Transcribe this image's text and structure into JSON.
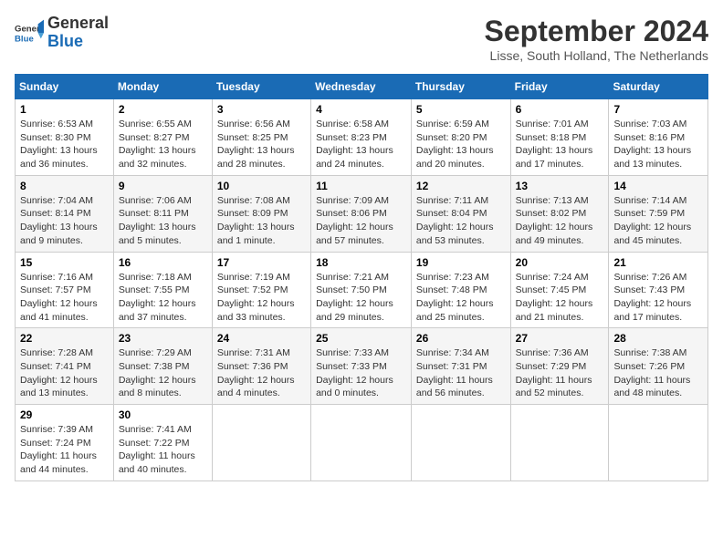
{
  "header": {
    "logo_general": "General",
    "logo_blue": "Blue",
    "month_title": "September 2024",
    "location": "Lisse, South Holland, The Netherlands"
  },
  "columns": [
    "Sunday",
    "Monday",
    "Tuesday",
    "Wednesday",
    "Thursday",
    "Friday",
    "Saturday"
  ],
  "weeks": [
    [
      {
        "day": "1",
        "info": "Sunrise: 6:53 AM\nSunset: 8:30 PM\nDaylight: 13 hours and 36 minutes."
      },
      {
        "day": "2",
        "info": "Sunrise: 6:55 AM\nSunset: 8:27 PM\nDaylight: 13 hours and 32 minutes."
      },
      {
        "day": "3",
        "info": "Sunrise: 6:56 AM\nSunset: 8:25 PM\nDaylight: 13 hours and 28 minutes."
      },
      {
        "day": "4",
        "info": "Sunrise: 6:58 AM\nSunset: 8:23 PM\nDaylight: 13 hours and 24 minutes."
      },
      {
        "day": "5",
        "info": "Sunrise: 6:59 AM\nSunset: 8:20 PM\nDaylight: 13 hours and 20 minutes."
      },
      {
        "day": "6",
        "info": "Sunrise: 7:01 AM\nSunset: 8:18 PM\nDaylight: 13 hours and 17 minutes."
      },
      {
        "day": "7",
        "info": "Sunrise: 7:03 AM\nSunset: 8:16 PM\nDaylight: 13 hours and 13 minutes."
      }
    ],
    [
      {
        "day": "8",
        "info": "Sunrise: 7:04 AM\nSunset: 8:14 PM\nDaylight: 13 hours and 9 minutes."
      },
      {
        "day": "9",
        "info": "Sunrise: 7:06 AM\nSunset: 8:11 PM\nDaylight: 13 hours and 5 minutes."
      },
      {
        "day": "10",
        "info": "Sunrise: 7:08 AM\nSunset: 8:09 PM\nDaylight: 13 hours and 1 minute."
      },
      {
        "day": "11",
        "info": "Sunrise: 7:09 AM\nSunset: 8:06 PM\nDaylight: 12 hours and 57 minutes."
      },
      {
        "day": "12",
        "info": "Sunrise: 7:11 AM\nSunset: 8:04 PM\nDaylight: 12 hours and 53 minutes."
      },
      {
        "day": "13",
        "info": "Sunrise: 7:13 AM\nSunset: 8:02 PM\nDaylight: 12 hours and 49 minutes."
      },
      {
        "day": "14",
        "info": "Sunrise: 7:14 AM\nSunset: 7:59 PM\nDaylight: 12 hours and 45 minutes."
      }
    ],
    [
      {
        "day": "15",
        "info": "Sunrise: 7:16 AM\nSunset: 7:57 PM\nDaylight: 12 hours and 41 minutes."
      },
      {
        "day": "16",
        "info": "Sunrise: 7:18 AM\nSunset: 7:55 PM\nDaylight: 12 hours and 37 minutes."
      },
      {
        "day": "17",
        "info": "Sunrise: 7:19 AM\nSunset: 7:52 PM\nDaylight: 12 hours and 33 minutes."
      },
      {
        "day": "18",
        "info": "Sunrise: 7:21 AM\nSunset: 7:50 PM\nDaylight: 12 hours and 29 minutes."
      },
      {
        "day": "19",
        "info": "Sunrise: 7:23 AM\nSunset: 7:48 PM\nDaylight: 12 hours and 25 minutes."
      },
      {
        "day": "20",
        "info": "Sunrise: 7:24 AM\nSunset: 7:45 PM\nDaylight: 12 hours and 21 minutes."
      },
      {
        "day": "21",
        "info": "Sunrise: 7:26 AM\nSunset: 7:43 PM\nDaylight: 12 hours and 17 minutes."
      }
    ],
    [
      {
        "day": "22",
        "info": "Sunrise: 7:28 AM\nSunset: 7:41 PM\nDaylight: 12 hours and 13 minutes."
      },
      {
        "day": "23",
        "info": "Sunrise: 7:29 AM\nSunset: 7:38 PM\nDaylight: 12 hours and 8 minutes."
      },
      {
        "day": "24",
        "info": "Sunrise: 7:31 AM\nSunset: 7:36 PM\nDaylight: 12 hours and 4 minutes."
      },
      {
        "day": "25",
        "info": "Sunrise: 7:33 AM\nSunset: 7:33 PM\nDaylight: 12 hours and 0 minutes."
      },
      {
        "day": "26",
        "info": "Sunrise: 7:34 AM\nSunset: 7:31 PM\nDaylight: 11 hours and 56 minutes."
      },
      {
        "day": "27",
        "info": "Sunrise: 7:36 AM\nSunset: 7:29 PM\nDaylight: 11 hours and 52 minutes."
      },
      {
        "day": "28",
        "info": "Sunrise: 7:38 AM\nSunset: 7:26 PM\nDaylight: 11 hours and 48 minutes."
      }
    ],
    [
      {
        "day": "29",
        "info": "Sunrise: 7:39 AM\nSunset: 7:24 PM\nDaylight: 11 hours and 44 minutes."
      },
      {
        "day": "30",
        "info": "Sunrise: 7:41 AM\nSunset: 7:22 PM\nDaylight: 11 hours and 40 minutes."
      },
      {
        "day": "",
        "info": ""
      },
      {
        "day": "",
        "info": ""
      },
      {
        "day": "",
        "info": ""
      },
      {
        "day": "",
        "info": ""
      },
      {
        "day": "",
        "info": ""
      }
    ]
  ]
}
